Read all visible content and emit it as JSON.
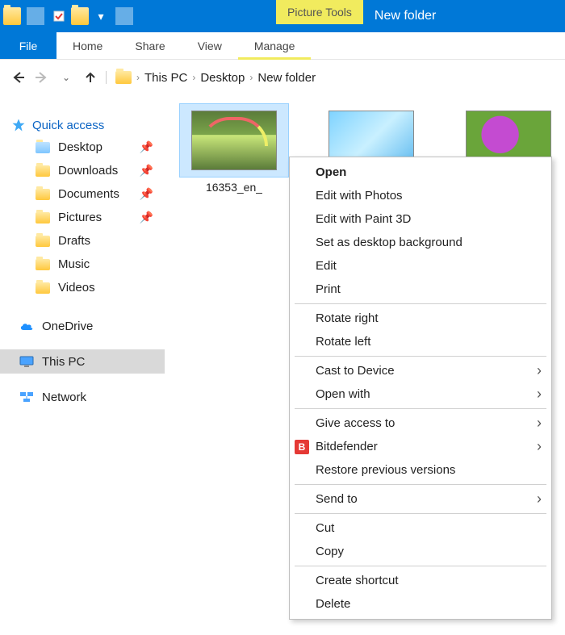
{
  "titlebar": {
    "picture_tools": "Picture Tools",
    "title": "New folder"
  },
  "ribbon": {
    "file": "File",
    "tabs": [
      "Home",
      "Share",
      "View"
    ],
    "manage": "Manage"
  },
  "breadcrumb": {
    "items": [
      "This PC",
      "Desktop",
      "New folder"
    ]
  },
  "sidebar": {
    "quick_access": "Quick access",
    "quick_items": [
      {
        "label": "Desktop",
        "pinned": true
      },
      {
        "label": "Downloads",
        "pinned": true
      },
      {
        "label": "Documents",
        "pinned": true
      },
      {
        "label": "Pictures",
        "pinned": true
      },
      {
        "label": "Drafts",
        "pinned": false
      },
      {
        "label": "Music",
        "pinned": false
      },
      {
        "label": "Videos",
        "pinned": false
      }
    ],
    "onedrive": "OneDrive",
    "this_pc": "This PC",
    "network": "Network"
  },
  "files": {
    "items": [
      {
        "label": "16353_en_",
        "selected": true,
        "kind": "rainbow"
      },
      {
        "label": "",
        "selected": false,
        "kind": "ice"
      },
      {
        "label": "",
        "selected": false,
        "kind": "flower"
      }
    ]
  },
  "context_menu": {
    "open": "Open",
    "edit_photos": "Edit with Photos",
    "edit_paint3d": "Edit with Paint 3D",
    "set_bg": "Set as desktop background",
    "edit": "Edit",
    "print": "Print",
    "rotate_r": "Rotate right",
    "rotate_l": "Rotate left",
    "cast": "Cast to Device",
    "open_with": "Open with",
    "give_access": "Give access to",
    "bitdefender": "Bitdefender",
    "restore": "Restore previous versions",
    "send_to": "Send to",
    "cut": "Cut",
    "copy": "Copy",
    "shortcut": "Create shortcut",
    "delete": "Delete"
  }
}
